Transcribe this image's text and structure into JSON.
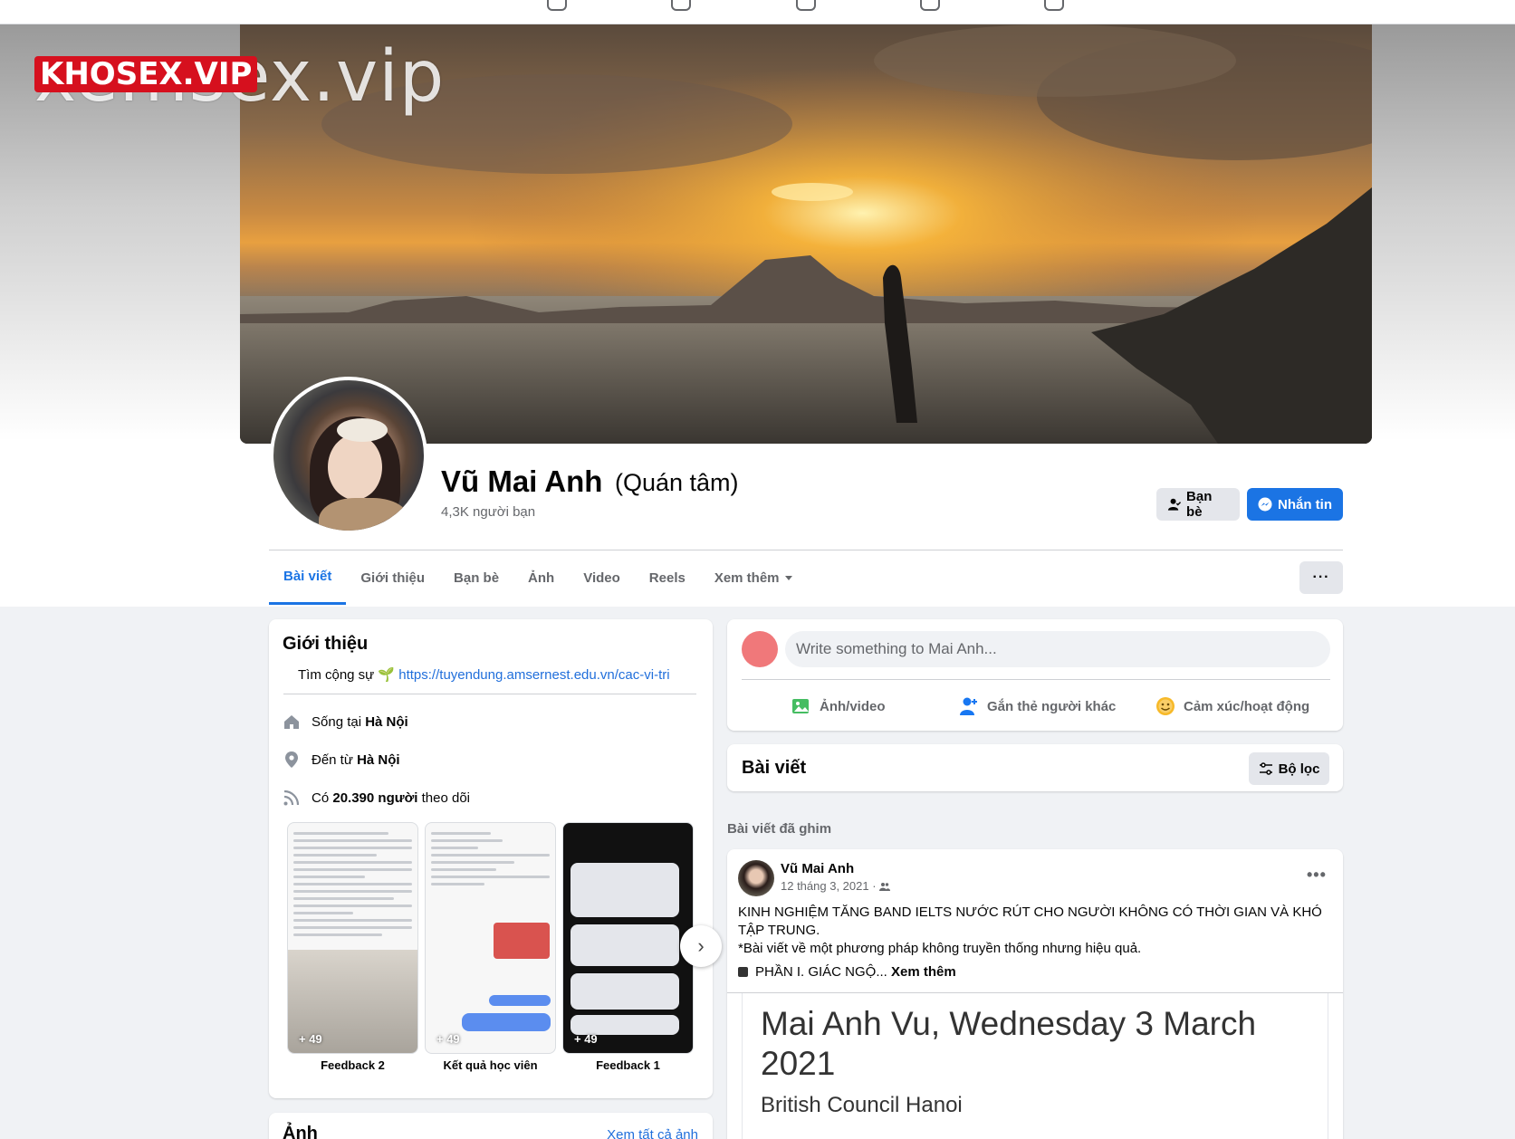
{
  "watermark": {
    "text": "xemsex.vip",
    "logo": "KHOSEX.VIP"
  },
  "profile": {
    "name": "Vũ Mai Anh",
    "alt_name": "(Quán tâm)",
    "friends_count": "4,3K người bạn"
  },
  "actions": {
    "friends_label": "Bạn bè",
    "message_label": "Nhắn tin"
  },
  "tabs": [
    {
      "label": "Bài viết",
      "active": true
    },
    {
      "label": "Giới thiệu"
    },
    {
      "label": "Bạn bè"
    },
    {
      "label": "Ảnh"
    },
    {
      "label": "Video"
    },
    {
      "label": "Reels"
    },
    {
      "label": "Xem thêm"
    }
  ],
  "more_label": "···",
  "intro": {
    "title": "Giới thiệu",
    "bio_text": "Tìm cộng sự 🌱",
    "bio_link": "https://tuyendung.amsernest.edu.vn/cac-vi-tri",
    "lives_prefix": "Sống tại",
    "lives_city": "Hà Nội",
    "from_prefix": "Đến từ",
    "from_city": "Hà Nội",
    "followers_prefix": "Có",
    "followers_count": "20.390 người",
    "followers_suffix": "theo dõi",
    "highlights": [
      {
        "label": "Feedback 2",
        "count": "+ 49"
      },
      {
        "label": "Kết quả học viên",
        "count": "+ 49"
      },
      {
        "label": "Feedback 1",
        "count": "+ 49"
      }
    ]
  },
  "photos": {
    "title": "Ảnh",
    "see_all": "Xem tất cả ảnh"
  },
  "composer": {
    "placeholder": "Write something to Mai Anh...",
    "photo_video": "Ảnh/video",
    "tag_people": "Gắn thẻ người khác",
    "feeling": "Cảm xúc/hoạt động"
  },
  "posts_section": {
    "title": "Bài viết",
    "filter_label": "Bộ lọc"
  },
  "pinned_label": "Bài viết đã ghim",
  "post": {
    "author": "Vũ Mai Anh",
    "date": "12 tháng 3, 2021 ·",
    "line1": "KINH NGHIỆM TĂNG BAND IELTS NƯỚC RÚT CHO NGƯỜI KHÔNG CÓ THỜI GIAN VÀ KHÓ TẬP TRUNG.",
    "line2": "*Bài viết về một phương pháp không truyền thống nhưng hiệu quả.",
    "line3": "PHẦN I. GIÁC NGỘ...",
    "see_more": "Xem thêm",
    "doc_title": "Mai Anh Vu, Wednesday 3 March 2021",
    "doc_subtitle": "British Council Hanoi"
  },
  "colors": {
    "accent": "#1b74e4",
    "link": "#216fdb",
    "background": "#f0f2f5"
  }
}
